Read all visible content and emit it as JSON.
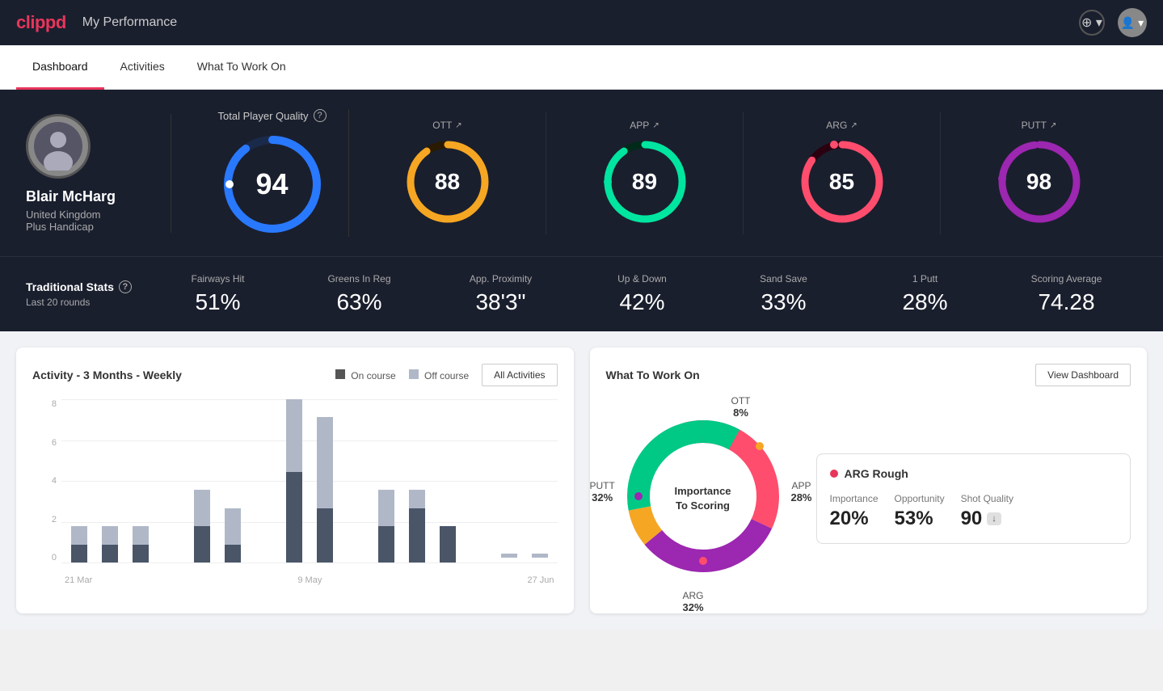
{
  "app": {
    "logo": "clippd",
    "title": "My Performance"
  },
  "nav": {
    "tabs": [
      {
        "id": "dashboard",
        "label": "Dashboard",
        "active": true
      },
      {
        "id": "activities",
        "label": "Activities",
        "active": false
      },
      {
        "id": "what-to-work-on",
        "label": "What To Work On",
        "active": false
      }
    ]
  },
  "player": {
    "name": "Blair McHarg",
    "country": "United Kingdom",
    "handicap": "Plus Handicap",
    "avatar_text": "👤"
  },
  "total_player_quality": {
    "label": "Total Player Quality",
    "value": 94,
    "color": "#2979ff",
    "trail_color": "#1a2a4a"
  },
  "score_cards": [
    {
      "id": "ott",
      "label": "OTT",
      "value": 88,
      "color": "#f5a623",
      "trail_color": "#2a1a00",
      "pct": 88
    },
    {
      "id": "app",
      "label": "APP",
      "value": 89,
      "color": "#00e5a0",
      "trail_color": "#002a1a",
      "pct": 89
    },
    {
      "id": "arg",
      "label": "ARG",
      "value": 85,
      "color": "#ff4d6d",
      "trail_color": "#2a0010",
      "pct": 85
    },
    {
      "id": "putt",
      "label": "PUTT",
      "value": 98,
      "color": "#9c27b0",
      "trail_color": "#1a0020",
      "pct": 98
    }
  ],
  "traditional_stats": {
    "title": "Traditional Stats",
    "subtitle": "Last 20 rounds",
    "items": [
      {
        "label": "Fairways Hit",
        "value": "51%"
      },
      {
        "label": "Greens In Reg",
        "value": "63%"
      },
      {
        "label": "App. Proximity",
        "value": "38'3\""
      },
      {
        "label": "Up & Down",
        "value": "42%"
      },
      {
        "label": "Sand Save",
        "value": "33%"
      },
      {
        "label": "1 Putt",
        "value": "28%"
      },
      {
        "label": "Scoring Average",
        "value": "74.28"
      }
    ]
  },
  "activity_chart": {
    "title": "Activity - 3 Months - Weekly",
    "legend": {
      "on_course": "On course",
      "off_course": "Off course"
    },
    "button": "All Activities",
    "y_labels": [
      "8",
      "6",
      "4",
      "2",
      "0"
    ],
    "x_labels": [
      "21 Mar",
      "9 May",
      "27 Jun"
    ],
    "bars": [
      {
        "on": 1,
        "off": 1
      },
      {
        "on": 1,
        "off": 1
      },
      {
        "on": 1,
        "off": 1
      },
      {
        "on": 0,
        "off": 0
      },
      {
        "on": 2,
        "off": 2
      },
      {
        "on": 1,
        "off": 2
      },
      {
        "on": 0,
        "off": 0
      },
      {
        "on": 5,
        "off": 4
      },
      {
        "on": 3,
        "off": 5
      },
      {
        "on": 0,
        "off": 0
      },
      {
        "on": 2,
        "off": 2
      },
      {
        "on": 3,
        "off": 1
      },
      {
        "on": 2,
        "off": 0
      },
      {
        "on": 0,
        "off": 0
      },
      {
        "on": 0,
        "off": 0.5
      },
      {
        "on": 0,
        "off": 0.5
      }
    ]
  },
  "what_to_work_on": {
    "title": "What To Work On",
    "button": "View Dashboard",
    "donut": {
      "center_line1": "Importance",
      "center_line2": "To Scoring",
      "segments": [
        {
          "id": "ott",
          "label": "OTT",
          "pct": "8%",
          "color": "#f5a623",
          "value": 8
        },
        {
          "id": "app",
          "label": "APP",
          "pct": "28%",
          "color": "#00e5a0",
          "value": 28
        },
        {
          "id": "arg",
          "label": "ARG",
          "pct": "32%",
          "color": "#ff4d6d",
          "value": 32
        },
        {
          "id": "putt",
          "label": "PUTT",
          "pct": "32%",
          "color": "#9c27b0",
          "value": 32
        }
      ]
    },
    "info_card": {
      "title": "ARG Rough",
      "dot_color": "#e8355a",
      "metrics": [
        {
          "label": "Importance",
          "value": "20%"
        },
        {
          "label": "Opportunity",
          "value": "53%"
        },
        {
          "label": "Shot Quality",
          "value": "90",
          "badge": "↓"
        }
      ]
    }
  }
}
